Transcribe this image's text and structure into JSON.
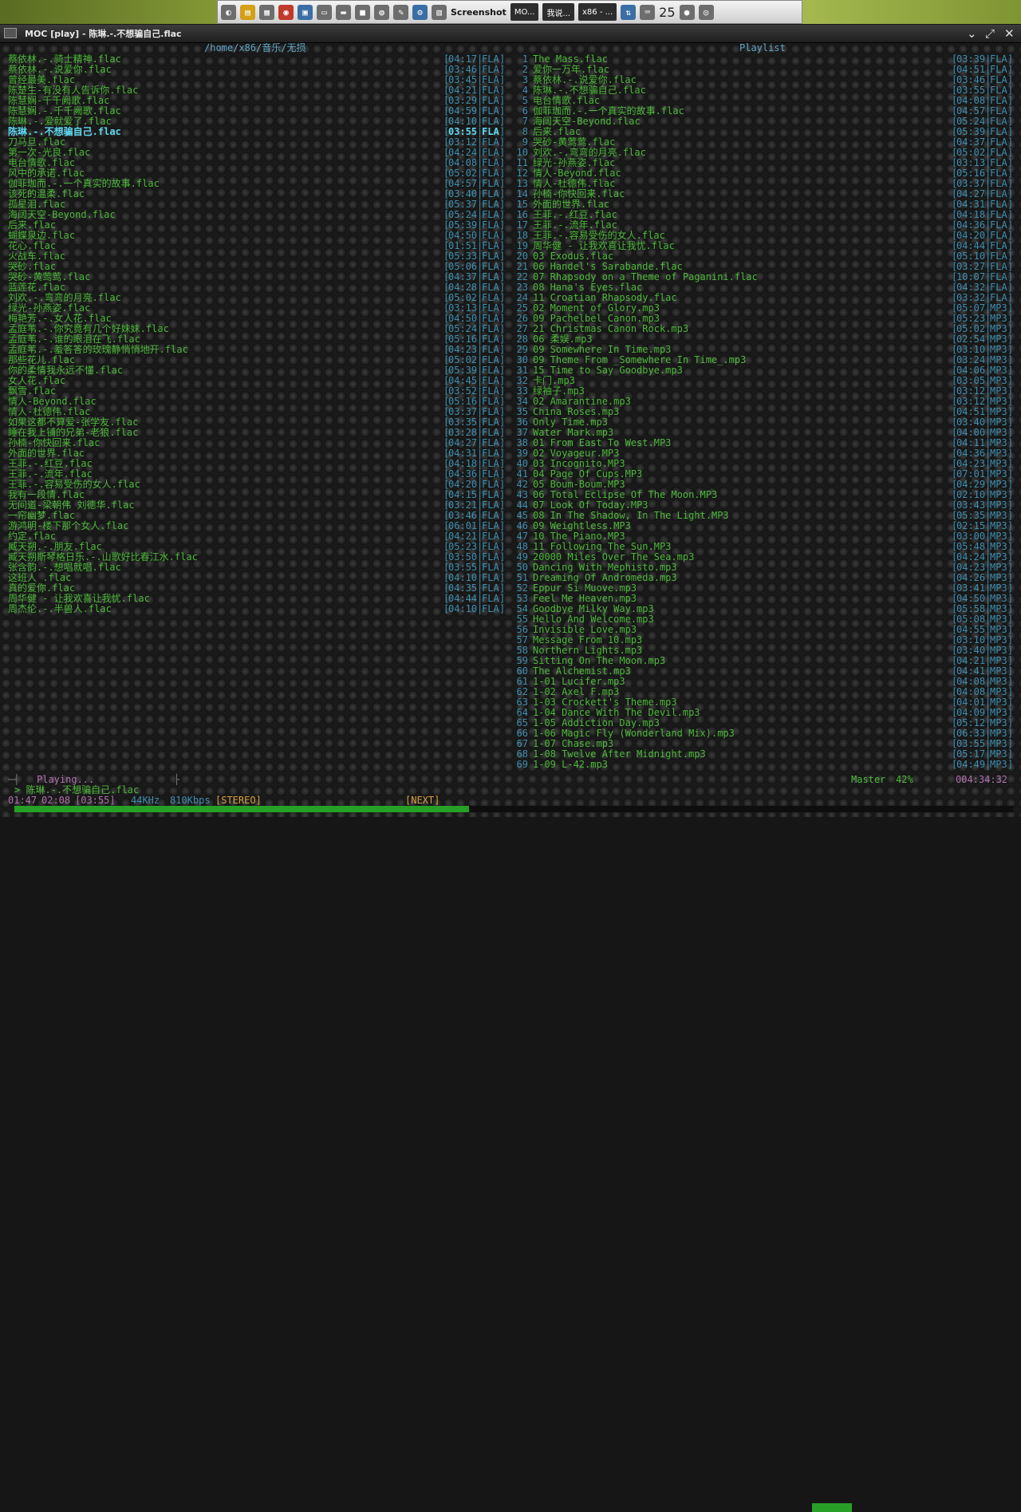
{
  "taskbar": {
    "screenshot_label": "Screenshot",
    "tasks": [
      "MO...",
      "我说...",
      "x86 - ..."
    ],
    "clock": "25"
  },
  "window": {
    "title": "MOC [play] - 陈琳.-.不想骗自己.flac"
  },
  "browser": {
    "header": "/home/x86/音乐/无损",
    "selected_index": 7,
    "items": [
      {
        "name": "蔡依林.-.骑士精神.flac",
        "time": "04:17",
        "fmt": "FLA"
      },
      {
        "name": "蔡依林.-.说爱你.flac",
        "time": "03:46",
        "fmt": "FLA"
      },
      {
        "name": "曾经最美.flac",
        "time": "03:45",
        "fmt": "FLA"
      },
      {
        "name": "陈楚生-有没有人告诉你.flac",
        "time": "04:21",
        "fmt": "FLA"
      },
      {
        "name": "陈慧娴-千千阙歌.flac",
        "time": "03:29",
        "fmt": "FLA"
      },
      {
        "name": "陈慧娴.-.千千阙歌.flac",
        "time": "04:59",
        "fmt": "FLA"
      },
      {
        "name": "陈琳.-.爱就爱了.flac",
        "time": "04:10",
        "fmt": "FLA"
      },
      {
        "name": "陈琳.-.不想骗自己.flac",
        "time": "03:55",
        "fmt": "FLA"
      },
      {
        "name": "刀马旦.flac",
        "time": "03:12",
        "fmt": "FLA"
      },
      {
        "name": "第一次-光良.flac",
        "time": "04:24",
        "fmt": "FLA"
      },
      {
        "name": "电台情歌.flac",
        "time": "04:08",
        "fmt": "FLA"
      },
      {
        "name": "风中的承诺.flac",
        "time": "05:02",
        "fmt": "FLA"
      },
      {
        "name": "伽菲珈而.-.一个真实的故事.flac",
        "time": "04:57",
        "fmt": "FLA"
      },
      {
        "name": "该死的温柔.flac",
        "time": "03:40",
        "fmt": "FLA"
      },
      {
        "name": "孤星泪.flac",
        "time": "05:37",
        "fmt": "FLA"
      },
      {
        "name": "海阔天空-Beyond.flac",
        "time": "05:24",
        "fmt": "FLA"
      },
      {
        "name": "后来.flac",
        "time": "05:39",
        "fmt": "FLA"
      },
      {
        "name": "蝴蝶泉边.flac",
        "time": "04:50",
        "fmt": "FLA"
      },
      {
        "name": "花心.flac",
        "time": "01:51",
        "fmt": "FLA"
      },
      {
        "name": "火战车.flac",
        "time": "05:33",
        "fmt": "FLA"
      },
      {
        "name": "哭砂.flac",
        "time": "05:06",
        "fmt": "FLA"
      },
      {
        "name": "哭砂-黄莺莺.flac",
        "time": "04:37",
        "fmt": "FLA"
      },
      {
        "name": "蓝莲花.flac",
        "time": "04:28",
        "fmt": "FLA"
      },
      {
        "name": "刘欢.-.弯弯的月亮.flac",
        "time": "05:02",
        "fmt": "FLA"
      },
      {
        "name": "绿光-孙燕姿.flac",
        "time": "03:13",
        "fmt": "FLA"
      },
      {
        "name": "梅艳芳.-.女人花.flac",
        "time": "04:50",
        "fmt": "FLA"
      },
      {
        "name": "孟庭苇.-.你究竟有几个好妹妹.flac",
        "time": "05:24",
        "fmt": "FLA"
      },
      {
        "name": "孟庭苇.-.谁的眼泪在飞.flac",
        "time": "05:16",
        "fmt": "FLA"
      },
      {
        "name": "孟庭苇.-.羞答答的玫瑰静悄悄地开.flac",
        "time": "04:23",
        "fmt": "FLA"
      },
      {
        "name": "那些花儿.flac",
        "time": "05:02",
        "fmt": "FLA"
      },
      {
        "name": "你的柔情我永远不懂.flac",
        "time": "05:39",
        "fmt": "FLA"
      },
      {
        "name": "女人花.flac",
        "time": "04:45",
        "fmt": "FLA"
      },
      {
        "name": "飘雪.flac",
        "time": "03:52",
        "fmt": "FLA"
      },
      {
        "name": "情人-Beyond.flac",
        "time": "05:16",
        "fmt": "FLA"
      },
      {
        "name": "情人-杜德伟.flac",
        "time": "03:37",
        "fmt": "FLA"
      },
      {
        "name": "如果这都不算爱-张学友.flac",
        "time": "03:35",
        "fmt": "FLA"
      },
      {
        "name": "睡在我上铺的兄弟-老狼.flac",
        "time": "03:28",
        "fmt": "FLA"
      },
      {
        "name": "孙楠-你快回来.flac",
        "time": "04:27",
        "fmt": "FLA"
      },
      {
        "name": "外面的世界.flac",
        "time": "04:31",
        "fmt": "FLA"
      },
      {
        "name": "王菲.-.红豆.flac",
        "time": "04:18",
        "fmt": "FLA"
      },
      {
        "name": "王菲.-.流年.flac",
        "time": "04:36",
        "fmt": "FLA"
      },
      {
        "name": "王菲.-.容易受伤的女人.flac",
        "time": "04:20",
        "fmt": "FLA"
      },
      {
        "name": "我有一段情.flac",
        "time": "04:15",
        "fmt": "FLA"
      },
      {
        "name": "无间道-梁朝伟 刘德华.flac",
        "time": "03:21",
        "fmt": "FLA"
      },
      {
        "name": "一帘幽梦.flac",
        "time": "03:46",
        "fmt": "FLA"
      },
      {
        "name": "游鸿明-楼下那个女人.flac",
        "time": "06:01",
        "fmt": "FLA"
      },
      {
        "name": "约定.flac",
        "time": "04:21",
        "fmt": "FLA"
      },
      {
        "name": "臧天朔.-.朋友.flac",
        "time": "05:23",
        "fmt": "FLA"
      },
      {
        "name": "臧天朔斯琴格日乐.-.山歌好比春江水.flac",
        "time": "03:50",
        "fmt": "FLA"
      },
      {
        "name": "张含韵.-.想唱就唱.flac",
        "time": "03:55",
        "fmt": "FLA"
      },
      {
        "name": "这班人 .flac",
        "time": "04:10",
        "fmt": "FLA"
      },
      {
        "name": "真的爱你.flac",
        "time": "04:35",
        "fmt": "FLA"
      },
      {
        "name": "周华健 - 让我欢喜让我忧.flac",
        "time": "04:44",
        "fmt": "FLA"
      },
      {
        "name": "周杰伦.-.半兽人.flac",
        "time": "04:10",
        "fmt": "FLA"
      }
    ]
  },
  "playlist": {
    "header": "Playlist",
    "items": [
      {
        "name": "The Mass.flac",
        "time": "03:39",
        "fmt": "FLA"
      },
      {
        "name": "爱你一万年.flac",
        "time": "04:51",
        "fmt": "FLA"
      },
      {
        "name": "蔡依林.-.说爱你.flac",
        "time": "03:46",
        "fmt": "FLA"
      },
      {
        "name": "陈琳.-.不想骗自己.flac",
        "time": "03:55",
        "fmt": "FLA"
      },
      {
        "name": "电台情歌.flac",
        "time": "04:08",
        "fmt": "FLA"
      },
      {
        "name": "伽菲珈而.-.一个真实的故事.flac",
        "time": "04:57",
        "fmt": "FLA"
      },
      {
        "name": "海阔天空-Beyond.flac",
        "time": "05:24",
        "fmt": "FLA"
      },
      {
        "name": "后来.flac",
        "time": "05:39",
        "fmt": "FLA"
      },
      {
        "name": "哭砂-黄莺莺.flac",
        "time": "04:37",
        "fmt": "FLA"
      },
      {
        "name": "刘欢.-.弯弯的月亮.flac",
        "time": "05:02",
        "fmt": "FLA"
      },
      {
        "name": "绿光-孙燕姿.flac",
        "time": "03:13",
        "fmt": "FLA"
      },
      {
        "name": "情人-Beyond.flac",
        "time": "05:16",
        "fmt": "FLA"
      },
      {
        "name": "情人-杜德伟.flac",
        "time": "03:37",
        "fmt": "FLA"
      },
      {
        "name": "孙楠-你快回来.flac",
        "time": "04:27",
        "fmt": "FLA"
      },
      {
        "name": "外面的世界.flac",
        "time": "04:31",
        "fmt": "FLA"
      },
      {
        "name": "王菲.-.红豆.flac",
        "time": "04:18",
        "fmt": "FLA"
      },
      {
        "name": "王菲.-.流年.flac",
        "time": "04:36",
        "fmt": "FLA"
      },
      {
        "name": "王菲.-.容易受伤的女人.flac",
        "time": "04:20",
        "fmt": "FLA"
      },
      {
        "name": "周华健 - 让我欢喜让我忧.flac",
        "time": "04:44",
        "fmt": "FLA"
      },
      {
        "name": "03 Exodus.flac",
        "time": "05:10",
        "fmt": "FLA"
      },
      {
        "name": "06 Handel's Sarabande.flac",
        "time": "03:27",
        "fmt": "FLA"
      },
      {
        "name": "07 Rhapsody on a Theme of Paganini.flac",
        "time": "10:07",
        "fmt": "FLA"
      },
      {
        "name": "08 Hana's Eyes.flac",
        "time": "04:32",
        "fmt": "FLA"
      },
      {
        "name": "11 Croatian Rhapsody.flac",
        "time": "03:32",
        "fmt": "FLA"
      },
      {
        "name": "02 Moment of Glory.mp3",
        "time": "05:07",
        "fmt": "MP3"
      },
      {
        "name": "09 Pachelbel Canon.mp3",
        "time": "05:23",
        "fmt": "MP3"
      },
      {
        "name": "21 Christmas Canon Rock.mp3",
        "time": "05:02",
        "fmt": "MP3"
      },
      {
        "name": "06 柔娱.mp3",
        "time": "02:54",
        "fmt": "MP3"
      },
      {
        "name": "09 Somewhere In Time.mp3",
        "time": "03:10",
        "fmt": "MP3"
      },
      {
        "name": "09 Theme From _Somewhere In Time_.mp3",
        "time": "03:24",
        "fmt": "MP3"
      },
      {
        "name": "15 Time to Say Goodbye.mp3",
        "time": "04:06",
        "fmt": "MP3"
      },
      {
        "name": "卡门.mp3",
        "time": "03:05",
        "fmt": "MP3"
      },
      {
        "name": "绿袖子.mp3",
        "time": "03:12",
        "fmt": "MP3"
      },
      {
        "name": "02 Amarantine.mp3",
        "time": "03:12",
        "fmt": "MP3"
      },
      {
        "name": "China Roses.mp3",
        "time": "04:51",
        "fmt": "MP3"
      },
      {
        "name": "Only Time.mp3",
        "time": "03:40",
        "fmt": "MP3"
      },
      {
        "name": "Water Mark.mp3",
        "time": "04:00",
        "fmt": "MP3"
      },
      {
        "name": "01 From East To West.MP3",
        "time": "04:11",
        "fmt": "MP3"
      },
      {
        "name": "02 Voyageur.MP3",
        "time": "04:36",
        "fmt": "MP3"
      },
      {
        "name": "03 Incognito.MP3",
        "time": "04:23",
        "fmt": "MP3"
      },
      {
        "name": "04 Page Of Cups.MP3",
        "time": "07:01",
        "fmt": "MP3"
      },
      {
        "name": "05 Boum-Boum.MP3",
        "time": "04:29",
        "fmt": "MP3"
      },
      {
        "name": "06 Total Eclipse Of The Moon.MP3",
        "time": "02:10",
        "fmt": "MP3"
      },
      {
        "name": "07 Look Of Today.MP3",
        "time": "03:43",
        "fmt": "MP3"
      },
      {
        "name": "08 In The Shadow, In The Light.MP3",
        "time": "05:35",
        "fmt": "MP3"
      },
      {
        "name": "09 Weightless.MP3",
        "time": "02:15",
        "fmt": "MP3"
      },
      {
        "name": "10 The Piano.MP3",
        "time": "03:00",
        "fmt": "MP3"
      },
      {
        "name": "11 Following The Sun.MP3",
        "time": "05:48",
        "fmt": "MP3"
      },
      {
        "name": "20000 Miles Over The Sea.mp3",
        "time": "04:24",
        "fmt": "MP3"
      },
      {
        "name": "Dancing With Mephisto.mp3",
        "time": "04:23",
        "fmt": "MP3"
      },
      {
        "name": "Dreaming Of Andromeda.mp3",
        "time": "04:26",
        "fmt": "MP3"
      },
      {
        "name": "Eppur Si Muove.mp3",
        "time": "03:41",
        "fmt": "MP3"
      },
      {
        "name": "Feel Me Heaven.mp3",
        "time": "04:50",
        "fmt": "MP3"
      },
      {
        "name": "Goodbye Milky Way.mp3",
        "time": "05:58",
        "fmt": "MP3"
      },
      {
        "name": "Hello And Welcome.mp3",
        "time": "05:08",
        "fmt": "MP3"
      },
      {
        "name": "Invisible Love.mp3",
        "time": "04:55",
        "fmt": "MP3"
      },
      {
        "name": "Message From 10.mp3",
        "time": "03:10",
        "fmt": "MP3"
      },
      {
        "name": "Northern Lights.mp3",
        "time": "03:40",
        "fmt": "MP3"
      },
      {
        "name": "Sitting On The Moon.mp3",
        "time": "04:21",
        "fmt": "MP3"
      },
      {
        "name": "The Alchemist.mp3",
        "time": "04:41",
        "fmt": "MP3"
      },
      {
        "name": "1-01 Lucifer.mp3",
        "time": "04:08",
        "fmt": "MP3"
      },
      {
        "name": "1-02 Axel F.mp3",
        "time": "04:08",
        "fmt": "MP3"
      },
      {
        "name": "1-03 Crockett's Theme.mp3",
        "time": "04:01",
        "fmt": "MP3"
      },
      {
        "name": "1-04 Dance With The Devil.mp3",
        "time": "04:09",
        "fmt": "MP3"
      },
      {
        "name": "1-05 Addiction Day.mp3",
        "time": "05:12",
        "fmt": "MP3"
      },
      {
        "name": "1-06 Magic Fly (Wonderland Mix).mp3",
        "time": "06:33",
        "fmt": "MP3"
      },
      {
        "name": "1-07 Chase.mp3",
        "time": "03:55",
        "fmt": "MP3"
      },
      {
        "name": "1-08 Twelve After Midnight.mp3",
        "time": "05:17",
        "fmt": "MP3"
      },
      {
        "name": "1-09 L-42.mp3",
        "time": "04:49",
        "fmt": "MP3"
      }
    ]
  },
  "status": {
    "state": "Playing...",
    "mixer_label": "Master",
    "volume_text": "42%",
    "volume": 0.42,
    "total_time": "004:34:32",
    "current_title": "> 陈琳.-.不想骗自己.flac",
    "elapsed": "01:47",
    "remaining": "02:08",
    "duration": "[03:55]",
    "rate": "44KHz",
    "bitrate": "810Kbps",
    "channels": "[STEREO]",
    "next_label": "[NEXT]",
    "progress": 0.455
  },
  "colors": {
    "file": "#4db83a",
    "time": "#3f8fb0",
    "selected": "#5ed8f0",
    "accent": "#25a225",
    "status_label": "#b070b0",
    "orange": "#d8a040"
  }
}
